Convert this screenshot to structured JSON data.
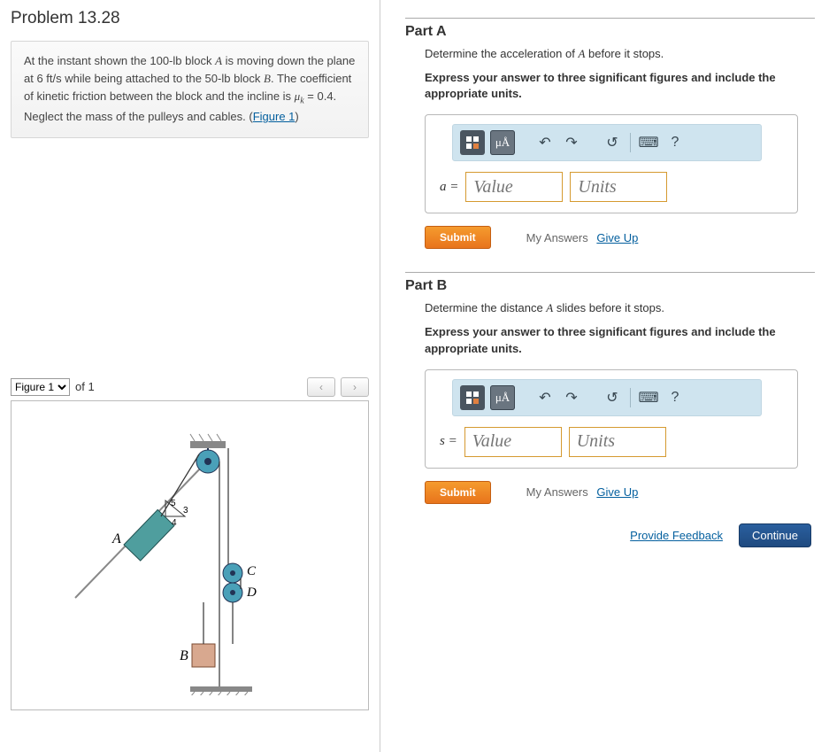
{
  "problem": {
    "title": "Problem 13.28",
    "text_html": "At the instant shown the 100-<span class='unit'>lb</span> block <span class='ital'>A</span> is moving down the plane at 6 <span class='unit'>ft/s</span> while being attached to the 50-<span class='unit'>lb</span> block <span class='ital'>B</span>. The coefficient of kinetic friction between the block and the incline is <span class='ital'>μ</span><span class='sub ital'>k</span> = 0.4. Neglect the mass of the pulleys and cables. (",
    "figure_link": "Figure 1",
    "text_tail": ")"
  },
  "figure_nav": {
    "select": "Figure 1",
    "of_label": "of 1"
  },
  "figure_labels": {
    "A": "A",
    "B": "B",
    "C": "C",
    "D": "D",
    "tri_top": "5",
    "tri_side": "3",
    "tri_base": "4"
  },
  "partA": {
    "title": "Part A",
    "desc_html": "Determine the acceleration of <span class='ital'>A</span> before it stops.",
    "instr": "Express your answer to three significant figures and include the appropriate units.",
    "eq_label": "a =",
    "value_ph": "Value",
    "units_ph": "Units",
    "submit": "Submit",
    "my_answers": "My Answers",
    "give_up": "Give Up",
    "mu_label": "μÅ"
  },
  "partB": {
    "title": "Part B",
    "desc_html": "Determine the distance <span class='ital'>A</span> slides before it stops.",
    "instr": "Express your answer to three significant figures and include the appropriate units.",
    "eq_label": "s =",
    "value_ph": "Value",
    "units_ph": "Units",
    "submit": "Submit",
    "my_answers": "My Answers",
    "give_up": "Give Up",
    "mu_label": "μÅ"
  },
  "footer": {
    "provide": "Provide Feedback",
    "continue": "Continue"
  },
  "toolbar_help": "?"
}
